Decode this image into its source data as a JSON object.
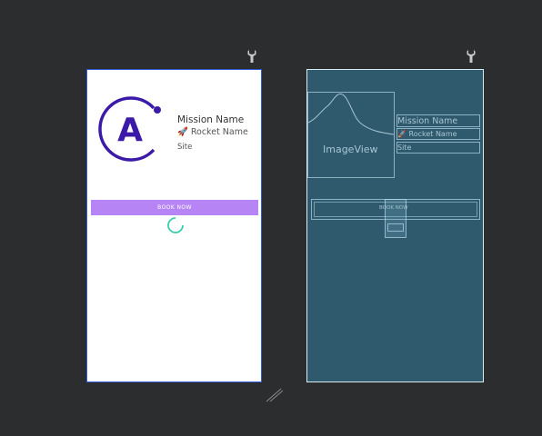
{
  "design": {
    "mission_name": "Mission Name",
    "rocket_name": "🚀 Rocket Name",
    "site": "Site",
    "book_button": "BOOK NOW",
    "spinner_label": "",
    "logo_letter": "A"
  },
  "blueprint": {
    "image_view_label": "ImageView",
    "mission_name": "Mission Name",
    "rocket_name": "🚀 Rocket Name",
    "site": "Site",
    "book_button": "BOOK NOW"
  },
  "colors": {
    "accent_purple": "#b684f5",
    "logo_indigo": "#3b1aa8",
    "spinner_teal": "#3ccab0",
    "blueprint_bg": "#2f5a6e"
  },
  "icons": [
    "wrench-icon",
    "rocket-icon",
    "resize-handle-icon"
  ]
}
